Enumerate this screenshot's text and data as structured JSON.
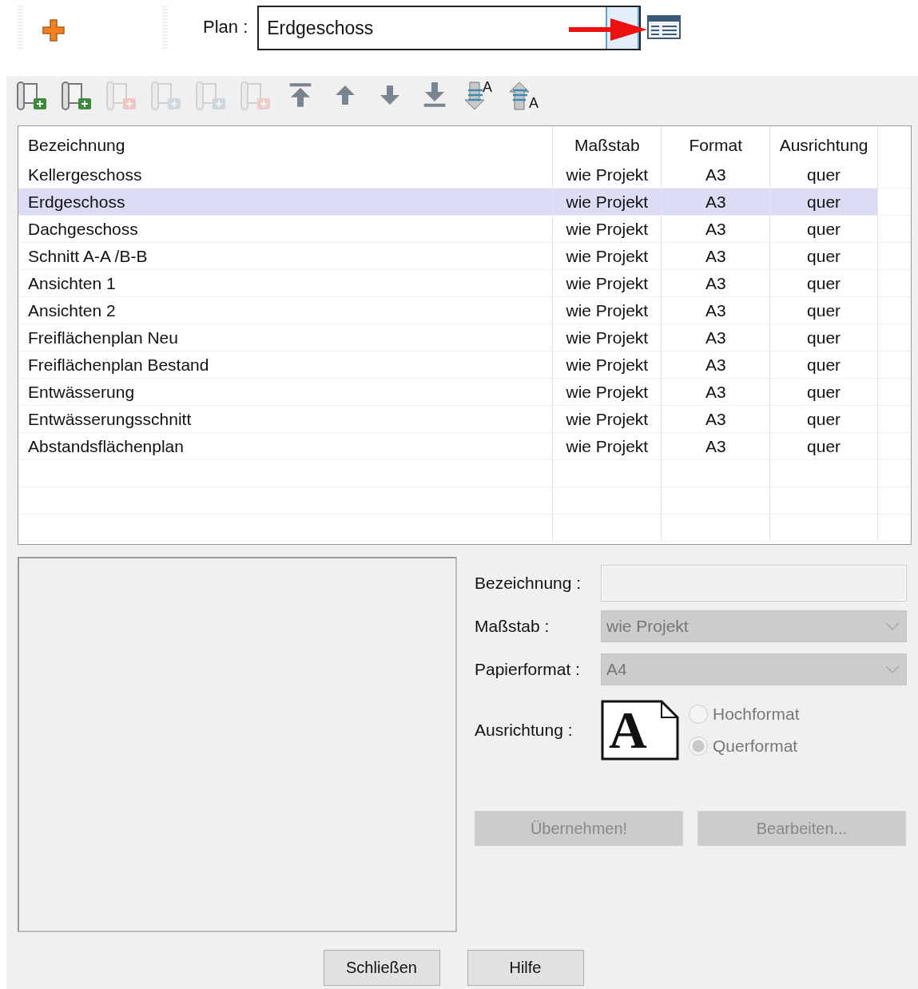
{
  "top_bar": {
    "plan_label": "Plan :",
    "plan_value": "Erdgeschoss"
  },
  "toolbar": [
    {
      "kind": "sheet-add",
      "disabled": false
    },
    {
      "kind": "sheet-export",
      "disabled": false
    },
    {
      "kind": "sheet-delete",
      "disabled": true
    },
    {
      "kind": "sheet-import",
      "disabled": true
    },
    {
      "kind": "sheet-copy",
      "disabled": true
    },
    {
      "kind": "sheet-mail",
      "disabled": true
    },
    {
      "kind": "move-top",
      "disabled": false
    },
    {
      "kind": "move-up",
      "disabled": false
    },
    {
      "kind": "move-down",
      "disabled": false
    },
    {
      "kind": "move-bottom",
      "disabled": false
    },
    {
      "kind": "sort-down",
      "disabled": false,
      "glyph": "A"
    },
    {
      "kind": "sort-up",
      "disabled": false,
      "glyph": "A"
    }
  ],
  "table": {
    "columns": [
      "Bezeichnung",
      "Maßstab",
      "Format",
      "Ausrichtung"
    ],
    "rows": [
      {
        "cells": [
          "Kellergeschoss",
          "wie Projekt",
          "A3",
          "quer"
        ],
        "selected": false
      },
      {
        "cells": [
          "Erdgeschoss",
          "wie Projekt",
          "A3",
          "quer"
        ],
        "selected": true
      },
      {
        "cells": [
          "Dachgeschoss",
          "wie Projekt",
          "A3",
          "quer"
        ],
        "selected": false
      },
      {
        "cells": [
          "Schnitt A-A /B-B",
          "wie Projekt",
          "A3",
          "quer"
        ],
        "selected": false
      },
      {
        "cells": [
          "Ansichten 1",
          "wie Projekt",
          "A3",
          "quer"
        ],
        "selected": false
      },
      {
        "cells": [
          "Ansichten 2",
          "wie Projekt",
          "A3",
          "quer"
        ],
        "selected": false
      },
      {
        "cells": [
          "Freiflächenplan Neu",
          "wie Projekt",
          "A3",
          "quer"
        ],
        "selected": false
      },
      {
        "cells": [
          "Freiflächenplan Bestand",
          "wie Projekt",
          "A3",
          "quer"
        ],
        "selected": false
      },
      {
        "cells": [
          "Entwässerung",
          "wie Projekt",
          "A3",
          "quer"
        ],
        "selected": false
      },
      {
        "cells": [
          "Entwässerungsschnitt",
          "wie Projekt",
          "A3",
          "quer"
        ],
        "selected": false
      },
      {
        "cells": [
          "Abstandsflächenplan",
          "wie Projekt",
          "A3",
          "quer"
        ],
        "selected": false
      }
    ]
  },
  "form": {
    "name_label": "Bezeichnung :",
    "scale_label": "Maßstab :",
    "scale_value": "wie Projekt",
    "paper_label": "Papierformat :",
    "paper_value": "A4",
    "orientation_label": "Ausrichtung :",
    "orientation_glyph": "A",
    "orientation_options": [
      {
        "label": "Hochformat",
        "selected": false
      },
      {
        "label": "Querformat",
        "selected": true
      }
    ],
    "buttons": [
      {
        "label": "Übernehmen!",
        "disabled": true
      },
      {
        "label": "Bearbeiten...",
        "disabled": true
      }
    ]
  },
  "footer_buttons": [
    "Schließen",
    "Hilfe"
  ]
}
